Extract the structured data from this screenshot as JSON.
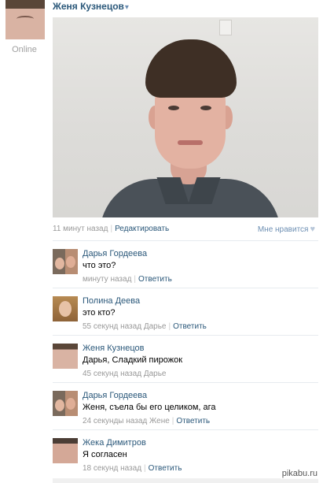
{
  "author": {
    "name": "Женя Кузнецов",
    "caret": "▾",
    "status": "Online"
  },
  "post": {
    "time": "11 минут назад",
    "edit_label": "Редактировать",
    "like_label": "Мне нравится",
    "like_icon": "♥"
  },
  "comments": [
    {
      "author": "Дарья Гордеева",
      "text": "что это?",
      "time": "минуту назад",
      "reply_to": "",
      "reply_label": "Ответить"
    },
    {
      "author": "Полина Деева",
      "text": "это кто?",
      "time": "55 секунд назад",
      "reply_to": "Дарье",
      "reply_label": "Ответить"
    },
    {
      "author": "Женя Кузнецов",
      "text": "Дарья, Сладкий пирожок",
      "time": "45 секунд назад",
      "reply_to": "Дарье",
      "reply_label": ""
    },
    {
      "author": "Дарья Гордеева",
      "text": "Женя, съела бы его целиком, ага",
      "time": "24 секунды назад",
      "reply_to": "Жене",
      "reply_label": "Ответить"
    },
    {
      "author": "Жека Димитров",
      "text": "Я согласен",
      "time": "18 секунд назад",
      "reply_to": "",
      "reply_label": "Ответить"
    }
  ],
  "separator": "|",
  "watermark": "pikabu.ru"
}
